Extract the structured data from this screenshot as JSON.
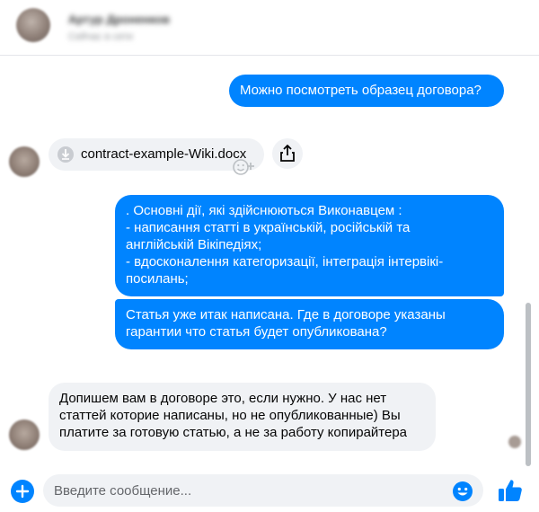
{
  "conversation": {
    "contact_name": "Артур Дроненков",
    "status": "Сейчас в сети"
  },
  "messages": {
    "m1": "Можно посмотреть образец договора?",
    "attachment": {
      "filename": "contract-example-Wiki.docx",
      "icon": "download-icon"
    },
    "m2_lines": [
      ". Основні дії, які здійснюються Виконавцем :",
      "- написання статті  в українській, російській та",
      "англійській Вікіпедіях;",
      "- вдосконалення категоризації, інтеграція інтервікі-",
      "посилань;"
    ],
    "m3_lines": [
      "Статья уже итак написана. Где в договоре указаны",
      "гарантии что статья будет опубликована?"
    ],
    "m4_lines": [
      "Допишем вам в договоре это, если нужно. У нас нет",
      "статтей которие написаны, но не опубликованные) Вы",
      "платите за готовую статью, а не за работу копирайтера"
    ]
  },
  "composer": {
    "placeholder": "Введите сообщение...",
    "plus_icon": "plus-icon",
    "emoji_icon": "emoji-icon",
    "like_icon": "thumbs-up-icon"
  },
  "colors": {
    "outgoing_bubble": "#0084ff",
    "incoming_bubble": "#f0f2f5",
    "accent": "#0084ff"
  }
}
